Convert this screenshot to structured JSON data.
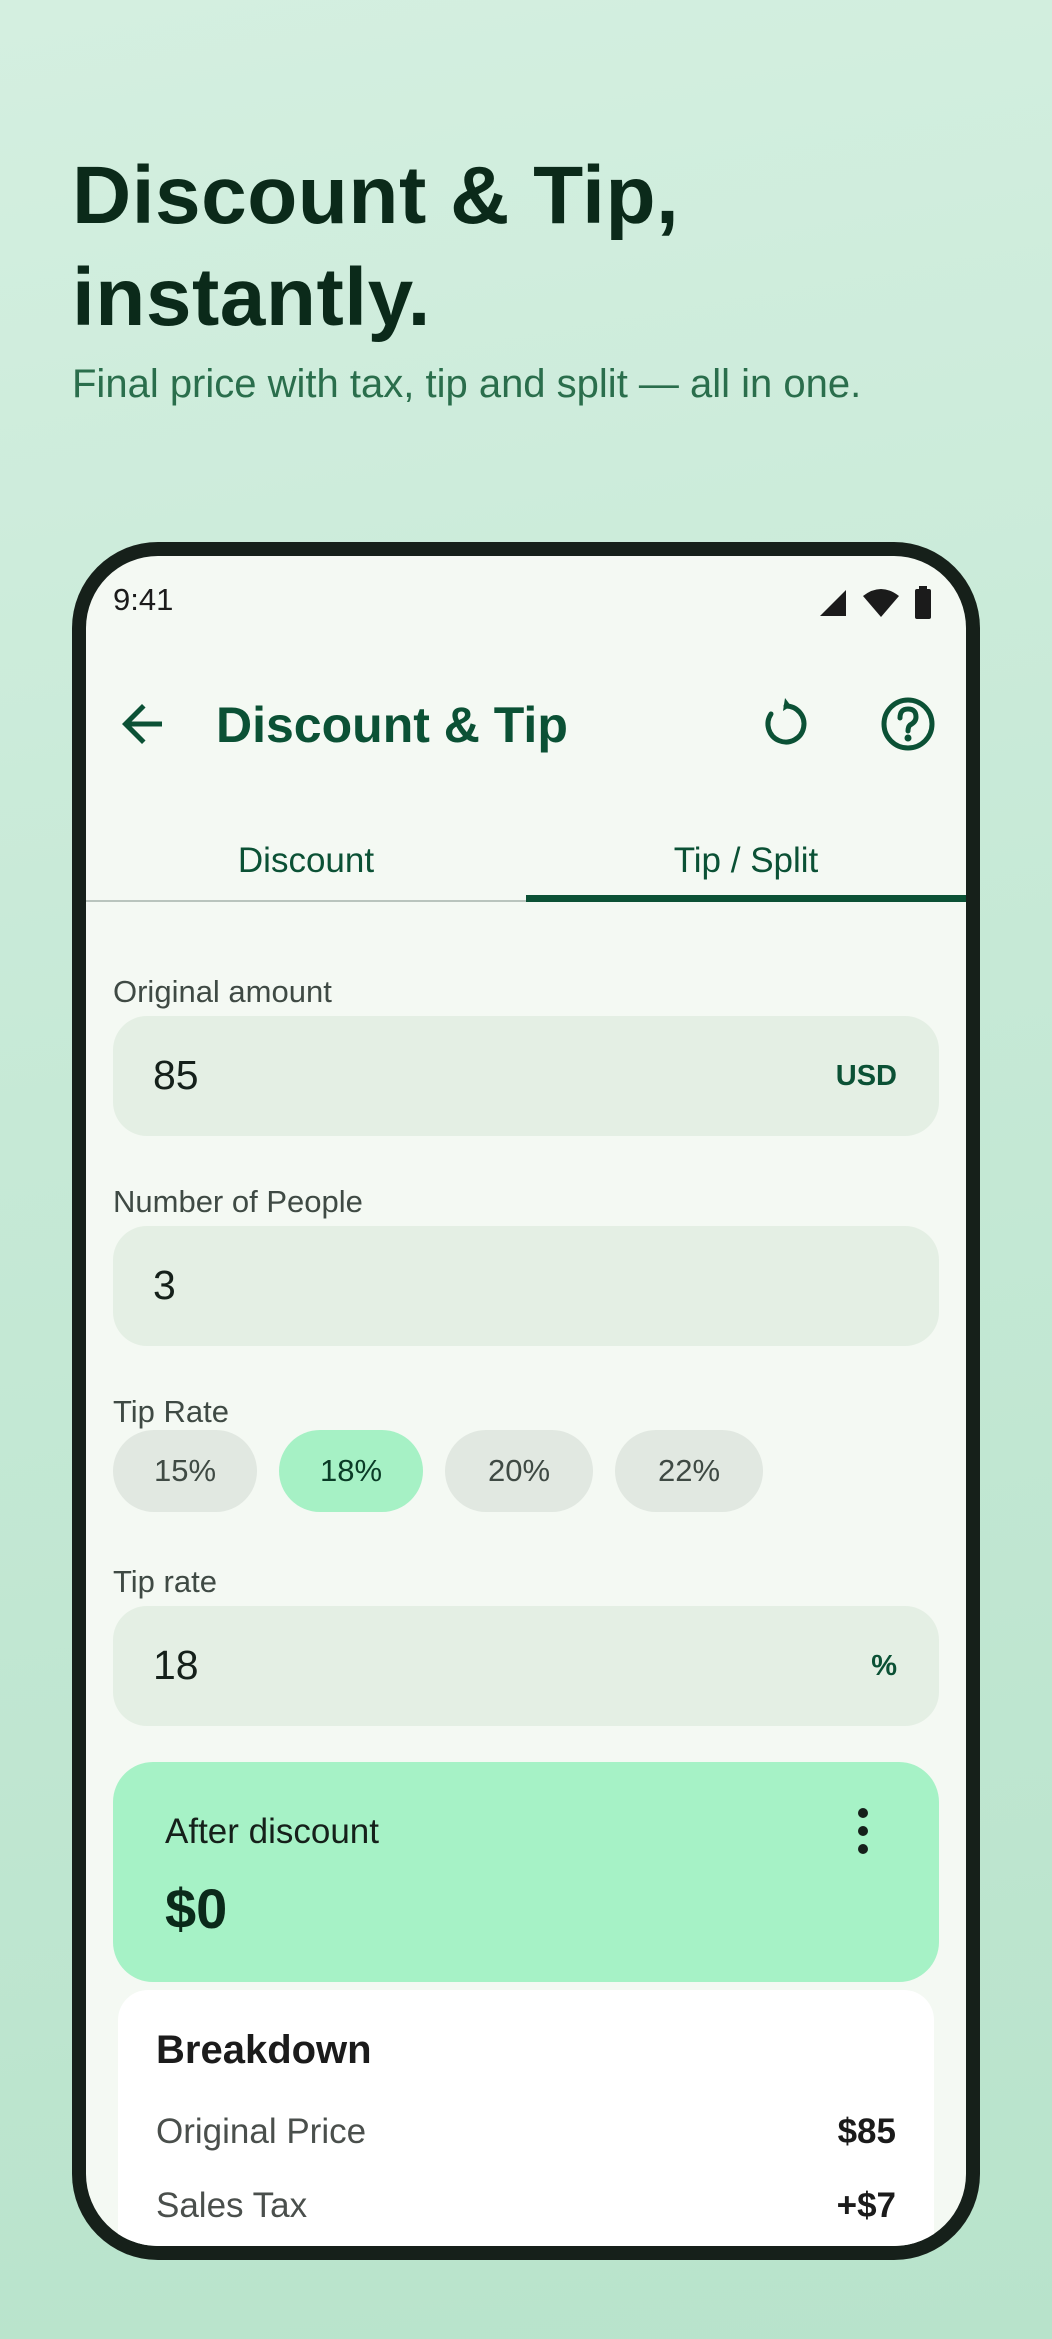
{
  "hero": {
    "title_line1": "Discount & Tip,",
    "title_line2": "instantly.",
    "subtitle": "Final price with tax, tip and split — all in one."
  },
  "status_bar": {
    "time": "9:41"
  },
  "app_bar": {
    "title": "Discount & Tip"
  },
  "tabs": [
    {
      "label": "Discount",
      "selected": false
    },
    {
      "label": "Tip / Split",
      "selected": true
    }
  ],
  "fields": {
    "original_amount": {
      "label": "Original amount",
      "value": "85",
      "suffix": "USD"
    },
    "people": {
      "label": "Number of People",
      "value": "3"
    },
    "tip_rate": {
      "label": "Tip rate",
      "value": "18",
      "suffix": "%"
    }
  },
  "tip_presets": {
    "label": "Tip Rate",
    "options": [
      "15%",
      "18%",
      "20%",
      "22%"
    ],
    "selected": "18%"
  },
  "result": {
    "label": "After discount",
    "value": "$0"
  },
  "breakdown": {
    "title": "Breakdown",
    "rows": [
      {
        "label": "Original Price",
        "value": "$85"
      },
      {
        "label": "Sales Tax",
        "value": "+$7"
      }
    ]
  },
  "colors": {
    "accent": "#0b5135",
    "chip_selected": "#a6f1c5",
    "result_card": "#a6f2c6",
    "field_bg": "#e4efe4"
  },
  "icons": [
    "back-arrow-icon",
    "refresh-icon",
    "help-icon",
    "signal-icon",
    "wifi-icon",
    "battery-icon",
    "more-vert-icon"
  ]
}
